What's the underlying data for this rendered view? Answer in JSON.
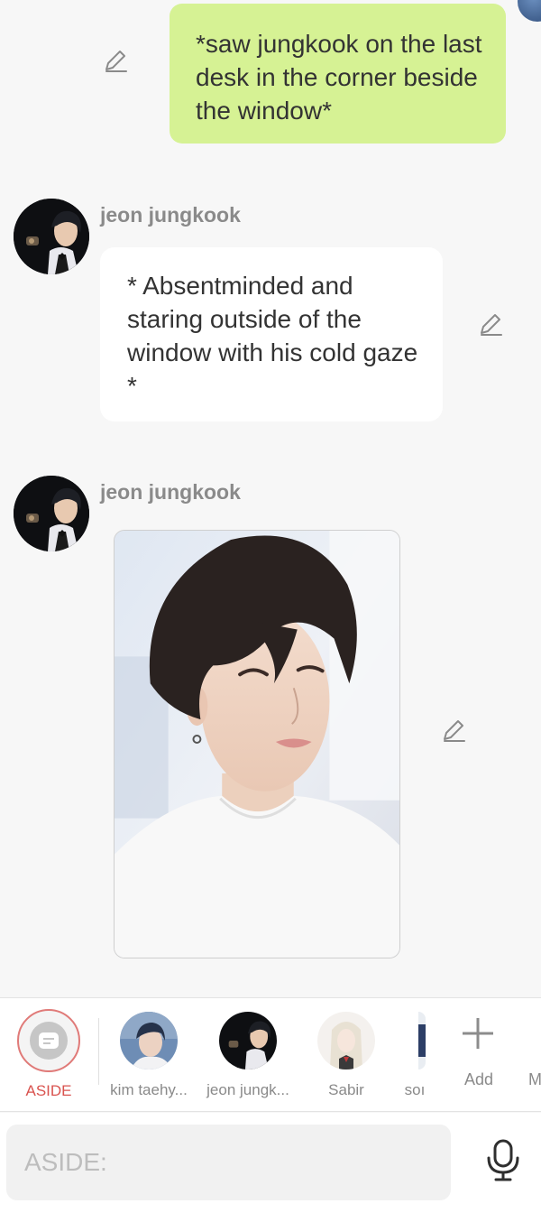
{
  "messages": {
    "user_message": {
      "text": "*saw jungkook on  the last desk in the corner beside the window*"
    },
    "char_message_1": {
      "name": "jeon jungkook",
      "text": "* Absentminded and staring outside of the window with his cold gaze *"
    },
    "char_message_2": {
      "name": "jeon jungkook"
    }
  },
  "selector": {
    "aside_label": "ASIDE",
    "items": [
      {
        "label": "kim taehy..."
      },
      {
        "label": "jeon jungk..."
      },
      {
        "label": "Sabir"
      },
      {
        "label": "soı"
      }
    ],
    "add_label": "Add",
    "more_label": "M"
  },
  "composer": {
    "placeholder": "ASIDE:"
  },
  "colors": {
    "user_bubble": "#d6f294",
    "accent": "#d9534f",
    "background": "#f7f7f7"
  },
  "icons": {
    "edit": "pencil-icon",
    "mic": "mic-icon",
    "add": "plus-icon",
    "aside": "chat-bubble-icon"
  }
}
